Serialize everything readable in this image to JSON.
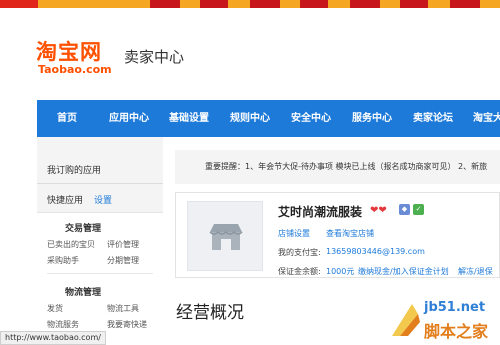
{
  "colors": {
    "brand_orange": "#ff5000",
    "nav_blue": "#1d7ad9",
    "link_blue": "#1d7ad9",
    "heart_red": "#e4393c"
  },
  "header": {
    "logo_cn": "淘宝网",
    "logo_en": "Taobao.com",
    "title": "卖家中心"
  },
  "nav": {
    "items": [
      "首页",
      "应用中心",
      "基础设置",
      "规则中心",
      "安全中心",
      "服务中心",
      "卖家论坛",
      "淘宝大"
    ]
  },
  "sidebar": {
    "my_apps": "我订购的应用",
    "quick_apps": "快捷应用",
    "settings": "设置",
    "trade_title": "交易管理",
    "trade_items": [
      "已卖出的宝贝",
      "评价管理",
      "采购助手",
      "分期管理"
    ],
    "logistics_title": "物流管理",
    "logistics_items": [
      "发货",
      "物流工具",
      "物流服务",
      "我要寄快递"
    ]
  },
  "notice": {
    "text": "重要提醒：1、年会节大促-待办事项 模块已上线（报名成功商家可见） 2、新旅"
  },
  "shop": {
    "name": "艾时尚潮流服装",
    "hearts": "❤❤",
    "links": [
      "店铺设置",
      "查看淘宝店铺"
    ],
    "alipay_label": "我的支付宝:",
    "alipay_value": "13659803446@139.com",
    "deposit_label": "保证金余额:",
    "deposit_value": "1000元",
    "deposit_actions": [
      "缴纳现金/加入保证金计划",
      "解冻/退保"
    ]
  },
  "main": {
    "section_title": "经营概况"
  },
  "status_bar": {
    "url": "http://www.taobao.com/"
  },
  "watermark": {
    "url": "jb51.net",
    "cn": "脚本之家"
  }
}
